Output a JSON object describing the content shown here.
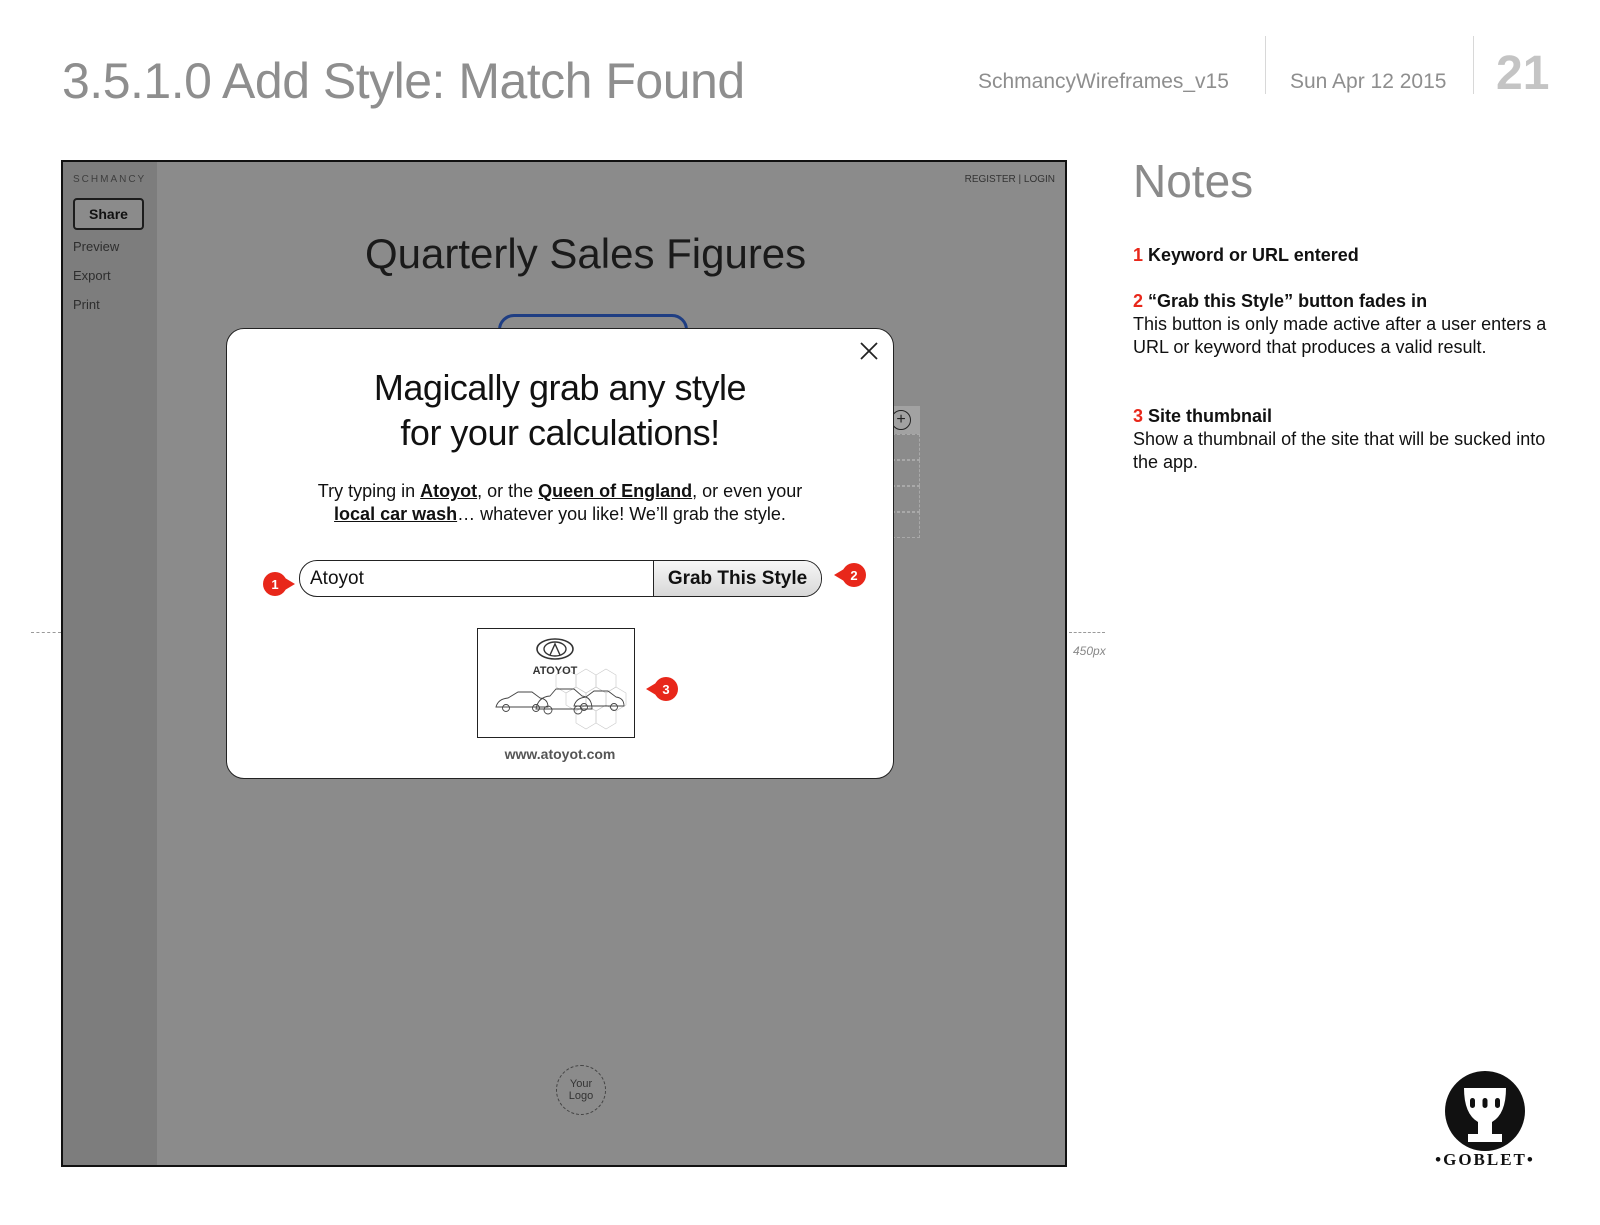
{
  "page": {
    "title": "3.5.1.0 Add Style: Match Found",
    "document_name": "SchmancyWireframes_v15",
    "date": "Sun Apr 12 2015",
    "page_number": "21"
  },
  "app": {
    "brand": "SCHMANCY",
    "share_label": "Share",
    "sidebar_links": [
      "Preview",
      "Export",
      "Print"
    ],
    "auth_links": "REGISTER | LOGIN",
    "heading": "Quarterly Sales Figures",
    "logo_placeholder": "Your Logo"
  },
  "modal": {
    "title_line1": "Magically grab any style",
    "title_line2": "for your calculations!",
    "hint": {
      "part1": "Try typing in ",
      "link1": "Atoyot",
      "part2": ", or the ",
      "link2": "Queen of England",
      "part3": ", or even your",
      "link3": "local car wash",
      "part4": "… whatever you like! We’ll grab the style."
    },
    "search_value": "Atoyot",
    "grab_button_label": "Grab This Style",
    "thumbnail_brand": "ATOYOT",
    "thumbnail_url": "www.atoyot.com"
  },
  "markers": [
    "1",
    "2",
    "3"
  ],
  "dimension_label": "450px",
  "notes": {
    "heading": "Notes",
    "items": [
      {
        "number": "1",
        "title": "Keyword or URL entered",
        "body": ""
      },
      {
        "number": "2",
        "title": "“Grab this Style” button fades in",
        "body": "This button is only made active after a user enters a URL or keyword that produces a valid result."
      },
      {
        "number": "3",
        "title": "Site thumbnail",
        "body": "Show a thumbnail of the site that will be sucked into the app."
      }
    ]
  },
  "footer_logo": {
    "wordmark": "•GOBLET•"
  },
  "colors": {
    "callout_red": "#e8271a",
    "overlay_gray": "#8b8b8b",
    "header_gray": "#8e8e8e",
    "accent_blue": "#1f3e83"
  }
}
